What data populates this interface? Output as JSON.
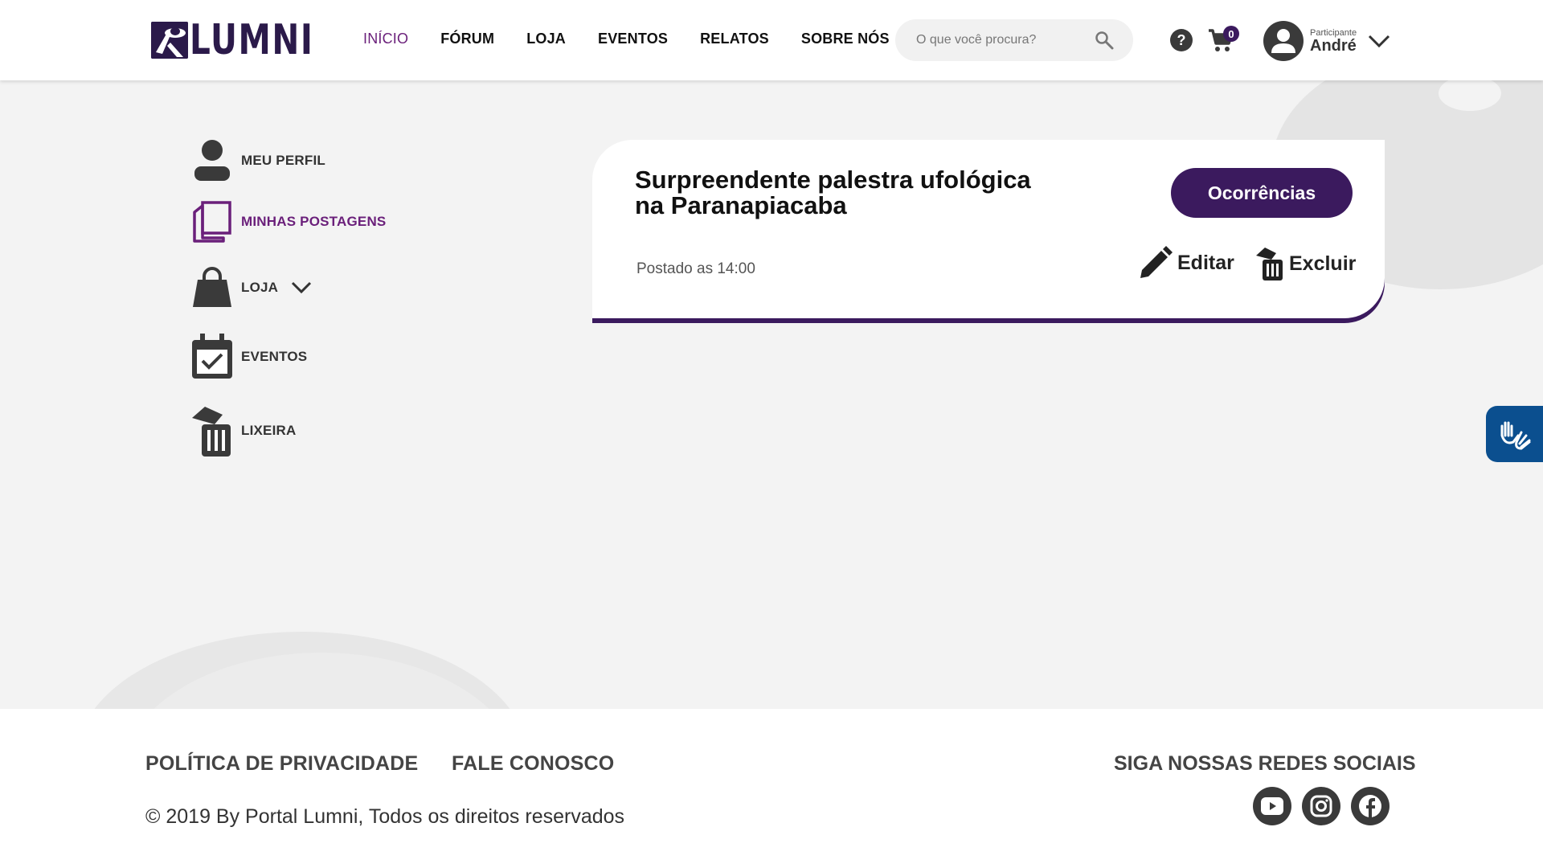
{
  "header": {
    "logo_text": "LUMNI",
    "nav": [
      "INÍCIO",
      "FÓRUM",
      "LOJA",
      "EVENTOS",
      "RELATOS",
      "SOBRE NÓS"
    ],
    "search_placeholder": "O que você procura?",
    "cart_count": "0",
    "user": {
      "role": "Participante",
      "name": "André"
    }
  },
  "sidebar": {
    "items": [
      {
        "label": "MEU PERFIL",
        "icon": "person-icon"
      },
      {
        "label": "MINHAS POSTAGENS",
        "icon": "documents-icon",
        "active": true
      },
      {
        "label": "LOJA",
        "icon": "shopping-bag-icon"
      },
      {
        "label": "EVENTOS",
        "icon": "calendar-check-icon"
      },
      {
        "label": "LIXEIRA",
        "icon": "trash-icon"
      }
    ]
  },
  "post": {
    "title_line1": "Surpreendente palestra ufológica",
    "title_line2": "na Paranapiacaba",
    "category": "Ocorrências",
    "posted": "Postado as 14:00",
    "edit_label": "Editar",
    "delete_label": "Excluir"
  },
  "footer": {
    "privacy": "POLÍTICA DE PRIVACIDADE",
    "contact": "FALE CONOSCO",
    "copyright": "© 2019 By Portal Lumni, Todos os direitos reservados",
    "social_title": "SIGA NOSSAS REDES SOCIAIS",
    "socials": [
      "youtube-icon",
      "instagram-icon",
      "facebook-icon"
    ]
  },
  "colors": {
    "brand_purple": "#3b1a5e",
    "active_purple": "#6a1f7a",
    "accessibility_blue": "#0b4f8f"
  }
}
